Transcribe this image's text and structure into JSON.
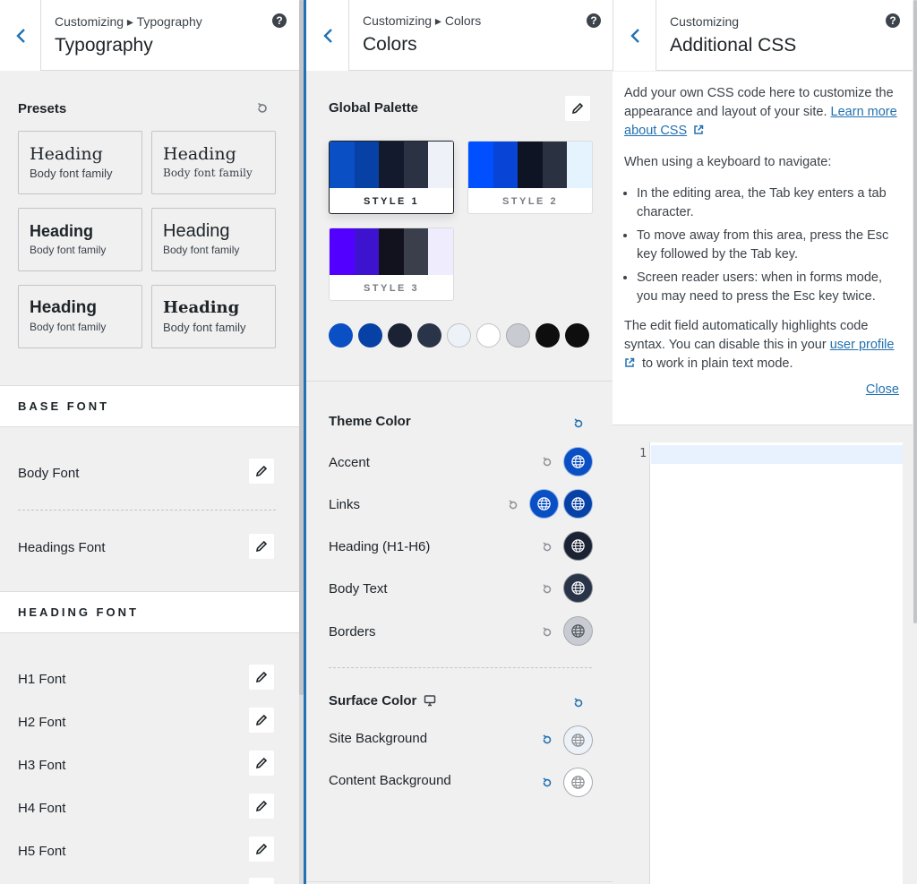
{
  "typography": {
    "crumb": "Customizing ▸ Typography",
    "title": "Typography",
    "presets_title": "Presets",
    "presets": [
      {
        "heading": "Heading",
        "body": "Body font family"
      },
      {
        "heading": "Heading",
        "body": "Body font family"
      },
      {
        "heading": "Heading",
        "body": "Body font family"
      },
      {
        "heading": "Heading",
        "body": "Body font family"
      },
      {
        "heading": "Heading",
        "body": "Body font family"
      },
      {
        "heading": "Heading",
        "body": "Body font family"
      }
    ],
    "base_font_band": "BASE FONT",
    "body_font": "Body Font",
    "headings_font": "Headings Font",
    "heading_font_band": "HEADING FONT",
    "heading_rows": [
      "H1 Font",
      "H2 Font",
      "H3 Font",
      "H4 Font",
      "H5 Font"
    ]
  },
  "colors": {
    "crumb": "Customizing ▸ Colors",
    "title": "Colors",
    "global_palette": "Global Palette",
    "palettes": [
      {
        "label": "STYLE 1",
        "colors": [
          "#0a4fc4",
          "#0841a5",
          "#141a2e",
          "#2a3244",
          "#eef2f8"
        ]
      },
      {
        "label": "STYLE 2",
        "colors": [
          "#0050ff",
          "#0845d6",
          "#0f1424",
          "#2a3140",
          "#e5f3ff"
        ]
      },
      {
        "label": "STYLE 3",
        "colors": [
          "#5200ff",
          "#3e13d0",
          "#12121f",
          "#3b3f4c",
          "#efedfd"
        ]
      }
    ],
    "swatches": [
      "#0a4fc4",
      "#0841a5",
      "#1b2233",
      "#2a3448",
      "#edf2f8",
      "#ffffff",
      "#c8cbd2",
      "#0e0e0e",
      "#0e0e0e"
    ],
    "theme_color": "Theme Color",
    "theme_rows": [
      "Accent",
      "Links",
      "Heading (H1-H6)",
      "Body Text",
      "Borders"
    ],
    "surface_color": "Surface Color",
    "surface_rows": [
      "Site Background",
      "Content Background"
    ],
    "accent_color": "#2271b1"
  },
  "css": {
    "crumb": "Customizing",
    "title": "Additional CSS",
    "intro": "Add your own CSS code here to customize the appearance and layout of your site. ",
    "learn_more": "Learn more about CSS",
    "keyboard_title": "When using a keyboard to navigate:",
    "bullets": [
      "In the editing area, the Tab key enters a tab character.",
      "To move away from this area, press the Esc key followed by the Tab key.",
      "Screen reader users: when in forms mode, you may need to press the Esc key twice."
    ],
    "outro_a": "The edit field automatically highlights code syntax. You can disable this in your ",
    "user_profile": "user profile",
    "outro_b": " to work in plain text mode.",
    "close": "Close",
    "line_number": "1"
  },
  "help_glyph": "?"
}
